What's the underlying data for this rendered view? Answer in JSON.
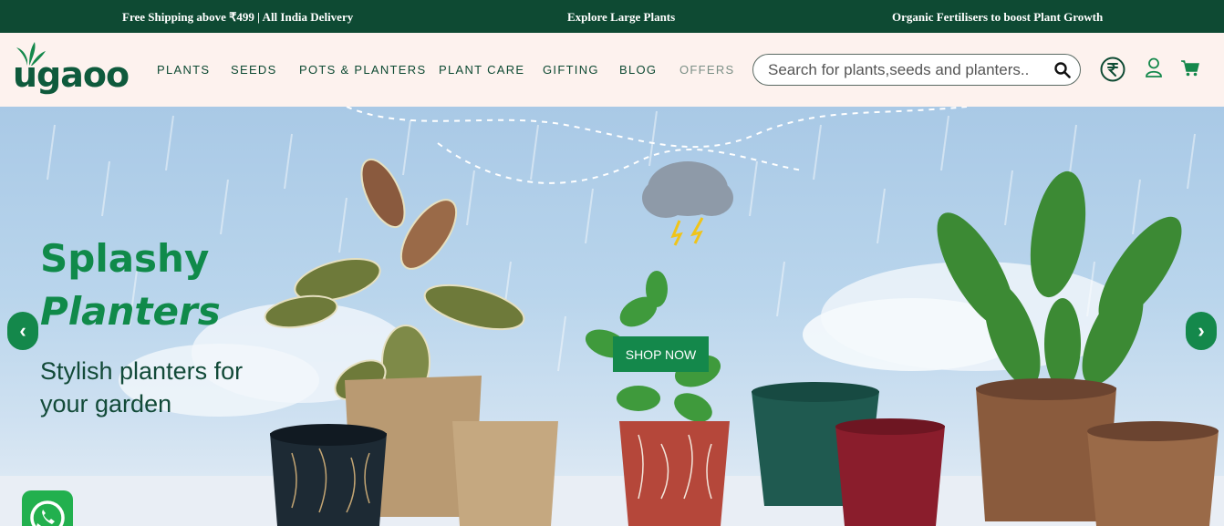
{
  "announcements": [
    "Free Shipping above ₹499 | All India Delivery",
    "Explore Large Plants",
    "Organic Fertilisers to boost Plant Growth"
  ],
  "header": {
    "logo_text": "ugaoo",
    "nav": [
      "PLANTS",
      "SEEDS",
      "POTS & PLANTERS",
      "PLANT CARE",
      "GIFTING",
      "BLOG",
      "OFFERS"
    ],
    "search_placeholder": "Search for plants,seeds and planters..",
    "icons": [
      "search-icon",
      "rupee-currency-icon",
      "user-icon",
      "cart-icon"
    ]
  },
  "hero": {
    "title_line1": "Splashy",
    "title_line2": "Planters",
    "subtitle": "Stylish planters for your garden",
    "cta": "SHOP NOW",
    "prev_label": "‹",
    "next_label": "›"
  },
  "colors": {
    "topbar": "#0e4a33",
    "header_bg": "#fdf2ee",
    "brand_green": "#14884b",
    "nav_text": "#0e4a33",
    "offers_text": "#7b8f86"
  }
}
